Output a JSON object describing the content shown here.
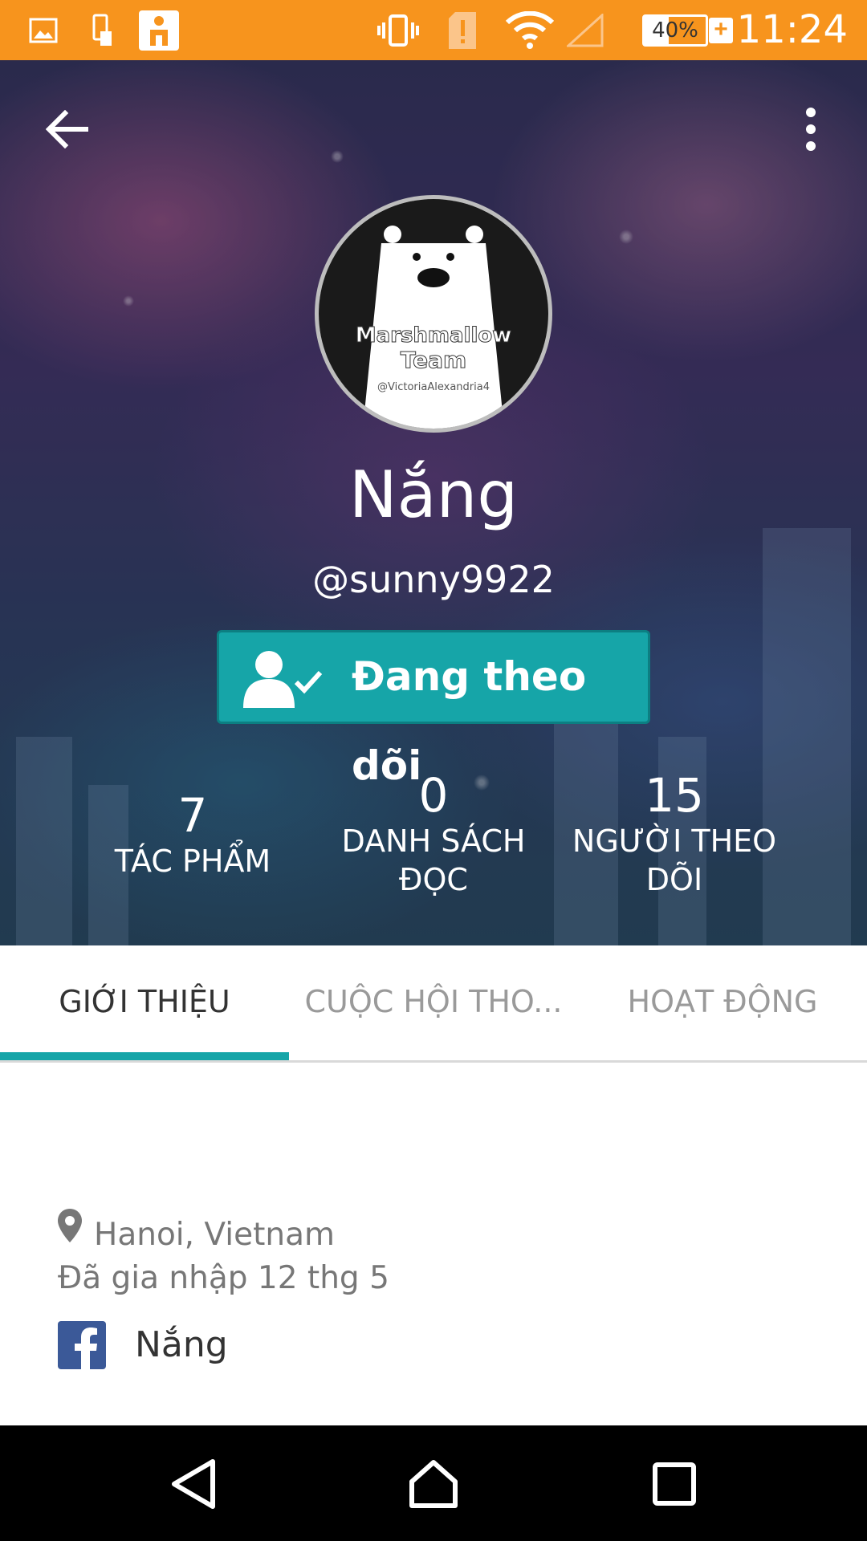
{
  "status_bar": {
    "time": "11:24",
    "battery_percent": "40%",
    "battery_level": 0.4,
    "icons": [
      "image-icon",
      "phone-rotate-icon",
      "app-icon",
      "vibrate-icon",
      "sim-alert-icon",
      "wifi-icon",
      "signal-icon",
      "battery-icon",
      "charging-icon"
    ]
  },
  "header": {
    "back_icon": "arrow-left-icon",
    "menu_icon": "more-vert-icon"
  },
  "profile": {
    "avatar_text_1": "Marshmallow",
    "avatar_text_2": "Team",
    "avatar_text_3": "@VictoriaAlexandria4",
    "name": "Nắng",
    "handle": "@sunny9922",
    "follow_button": "Đang theo dõi"
  },
  "stats": [
    {
      "value": "7",
      "label_1": "TÁC PHẨM",
      "label_2": ""
    },
    {
      "value": "0",
      "label_1": "DANH SÁCH",
      "label_2": "ĐỌC"
    },
    {
      "value": "15",
      "label_1": "NGƯỜI THEO",
      "label_2": "DÕI"
    }
  ],
  "tabs": [
    {
      "label": "GIỚI THIỆU",
      "active": true
    },
    {
      "label": "CUỘC HỘI THO...",
      "active": false
    },
    {
      "label": "HOẠT ĐỘNG",
      "active": false
    }
  ],
  "about": {
    "location": "Hanoi, Vietnam",
    "joined": "Đã gia nhập 12 thg 5",
    "facebook_name": "Nắng"
  },
  "colors": {
    "status_bar": "#f7941d",
    "accent": "#16a5a8",
    "facebook": "#3b5998"
  }
}
